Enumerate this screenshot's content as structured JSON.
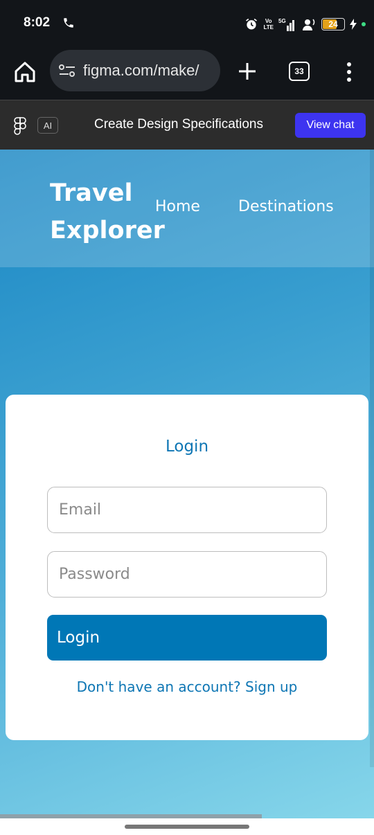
{
  "status_bar": {
    "time": "8:02",
    "network_top": "Vo",
    "network_bottom": "LTE",
    "signal_label": "5G",
    "battery_level": "24",
    "battery_fraction": 0.24,
    "battery_color": "#e3a21a"
  },
  "browser": {
    "url": "figma.com/make/",
    "tab_count": "33"
  },
  "figma_bar": {
    "ai_label": "AI",
    "title": "Create Design Specifications",
    "view_chat_label": "View chat",
    "accent": "#3d34f0"
  },
  "site": {
    "brand": "Travel Explorer",
    "nav": [
      "Home",
      "Destinations"
    ]
  },
  "login": {
    "title": "Login",
    "email_placeholder": "Email",
    "password_placeholder": "Password",
    "button_label": "Login",
    "signup_text": "Don't have an account? Sign up",
    "primary_color": "#0077b6"
  },
  "icons": {
    "call": "phone-icon",
    "alarm": "alarm-icon",
    "signal": "signal-icon",
    "hotspot": "hotspot-icon",
    "charging": "bolt-icon",
    "home": "home-icon",
    "site_settings": "tune-icon",
    "new_tab": "plus-icon",
    "menu": "more-vert-icon",
    "figma": "figma-logo-icon"
  }
}
